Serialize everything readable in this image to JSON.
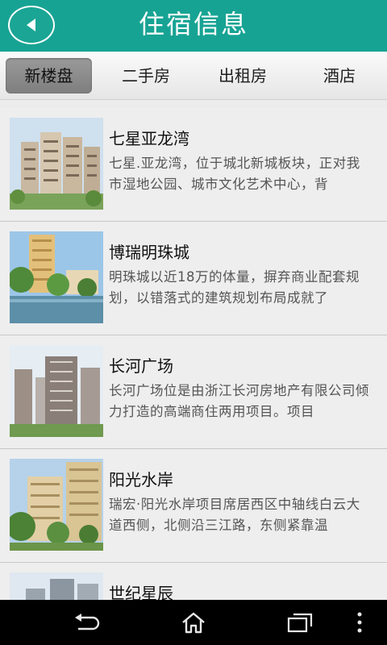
{
  "header": {
    "title": "住宿信息",
    "back_icon": "back-arrow-icon",
    "color": "#17a394"
  },
  "tabs": [
    {
      "label": "新楼盘",
      "active": true
    },
    {
      "label": "二手房",
      "active": false
    },
    {
      "label": "出租房",
      "active": false
    },
    {
      "label": "酒店",
      "active": false
    }
  ],
  "listings": [
    {
      "title": "七星亚龙湾",
      "desc": "七星.亚龙湾，位于城北新城板块，正对我市湿地公园、城市文化艺术中心，背"
    },
    {
      "title": "博瑞明珠城",
      "desc": "明珠城以近18万的体量，摒弃商业配套规划，以错落式的建筑规划布局成就了"
    },
    {
      "title": "长河广场",
      "desc": "长河广场位是由浙江长河房地产有限公司倾力打造的高端商住两用项目。项目"
    },
    {
      "title": "阳光水岸",
      "desc": "瑞宏·阳光水岸项目席居西区中轴线白云大道西侧，北侧沿三江路，东侧紧靠温"
    },
    {
      "title": "世纪星辰",
      "desc": ""
    }
  ],
  "navbar": {
    "icons": [
      "back-icon",
      "home-icon",
      "recent-apps-icon",
      "menu-icon"
    ]
  }
}
